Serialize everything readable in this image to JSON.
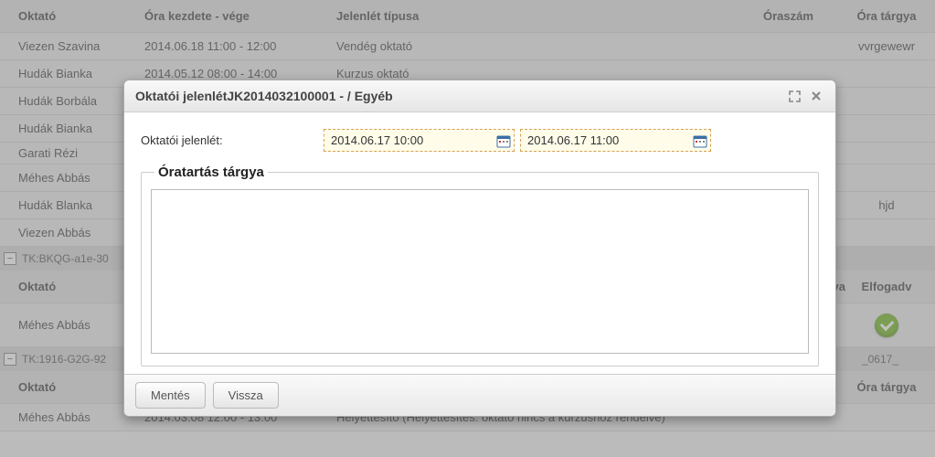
{
  "bg": {
    "headers": {
      "c1": "Oktató",
      "c2": "Óra kezdete - vége",
      "c3": "Jelenlét típusa",
      "c4": "Óraszám",
      "c5": "Óra tárgya"
    },
    "rows1": [
      {
        "c1": "Viezen Szavina",
        "c2": "2014.06.18 11:00 - 12:00",
        "c3": "Vendég oktató",
        "c5": "vvrgewewr"
      },
      {
        "c1": "Hudák Bianka",
        "c2": "2014.05.12 08:00 - 14:00",
        "c3": "Kurzus oktató",
        "c5": ""
      },
      {
        "c1": "Hudák Borbála",
        "c2": "",
        "c3": "",
        "c5": ""
      },
      {
        "c1": "Hudák Bianka",
        "c2": "",
        "c3": "",
        "c5": ""
      },
      {
        "c1": "Garati Rézi",
        "c2": "",
        "c3": "",
        "c5": ""
      },
      {
        "c1": "Méhes Abbás",
        "c2": "",
        "c3": "",
        "c5": ""
      },
      {
        "c1": "Hudák Blanka",
        "c2": "",
        "c3": "",
        "c5": "hjd"
      },
      {
        "c1": "Viezen Abbás",
        "c2": "",
        "c3": "",
        "c5": ""
      }
    ],
    "group2": "TK:BKQG-a1e-30",
    "headers2": {
      "c1": "Oktató",
      "c4_partial": "va",
      "c5": "Elfogadv"
    },
    "rows2": [
      {
        "c1": "Méhes Abbás",
        "check": true
      }
    ],
    "group3": "TK:1916-G2G-92",
    "group3_right": "_0617_",
    "headers3": {
      "c1": "Oktató",
      "c5": "Óra tárgya"
    },
    "rows3": [
      {
        "c1": "Méhes Abbás",
        "c2": "2014.03.08 12:00 - 13:00",
        "c3": "Helyettesíto (Helyettesítés: oktató nincs a kurzushoz rendelve)"
      }
    ]
  },
  "dialog": {
    "title": "Oktatói jelenlétJK2014032100001 - / Egyéb",
    "form": {
      "label": "Oktatói jelenlét:",
      "date_from": "2014.06.17 10:00",
      "date_to": "2014.06.17 11:00",
      "fieldset_legend": "Óratartás tárgya",
      "textarea_value": ""
    },
    "buttons": {
      "save": "Mentés",
      "back": "Vissza"
    }
  }
}
